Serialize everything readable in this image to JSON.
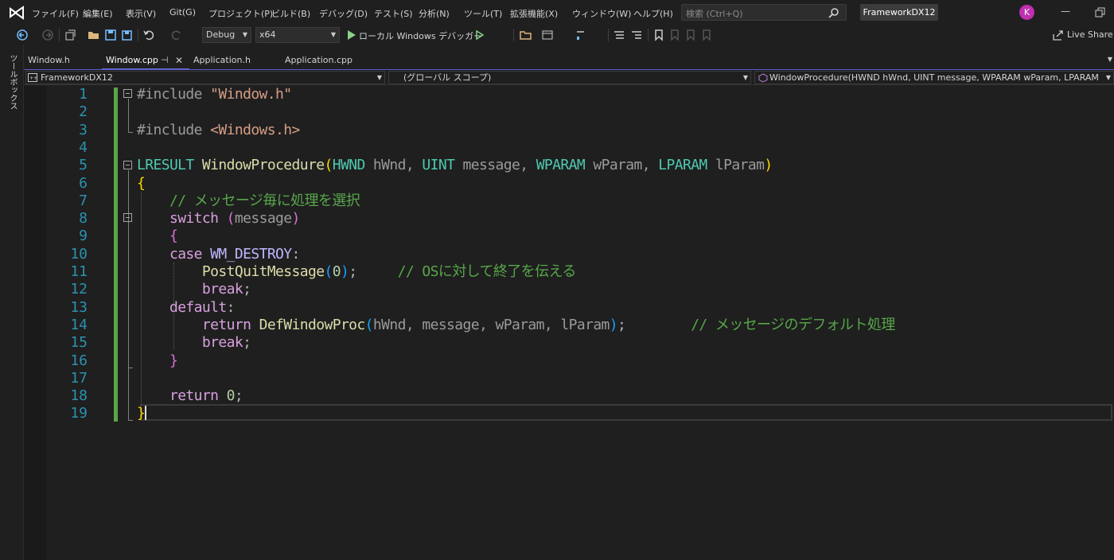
{
  "menu": {
    "items": [
      "ファイル(F)",
      "編集(E)",
      "表示(V)",
      "Git(G)",
      "プロジェクト(P)",
      "ビルド(B)",
      "デバッグ(D)",
      "テスト(S)",
      "分析(N)",
      "ツール(T)",
      "拡張機能(X)",
      "ウィンドウ(W)",
      "ヘルプ(H)"
    ],
    "search_placeholder": "検索 (Ctrl+Q)",
    "solution_name": "FrameworkDX12",
    "avatar_initial": "K"
  },
  "toolbar": {
    "config": "Debug",
    "platform": "x64",
    "run_label": "ローカル Windows デバッガー",
    "live_share": "Live Share"
  },
  "toolbox_label": "ツールボックス",
  "tabs": [
    {
      "label": "Window.h",
      "active": false
    },
    {
      "label": "Window.cpp",
      "active": true
    },
    {
      "label": "Application.h",
      "active": false
    },
    {
      "label": "Application.cpp",
      "active": false
    }
  ],
  "navbar": {
    "project": "FrameworkDX12",
    "scope": "(グローバル スコープ)",
    "member": "WindowProcedure(HWND hWnd, UINT message, WPARAM wParam, LPARAM lParam)"
  },
  "code": {
    "line_numbers": [
      "1",
      "2",
      "3",
      "4",
      "5",
      "6",
      "7",
      "8",
      "9",
      "10",
      "11",
      "12",
      "13",
      "14",
      "15",
      "16",
      "17",
      "18",
      "19"
    ],
    "lines": [
      [
        {
          "t": "#include ",
          "c": "pp"
        },
        {
          "t": "\"Window.h\"",
          "c": "str"
        }
      ],
      [],
      [
        {
          "t": "#include ",
          "c": "pp"
        },
        {
          "t": "<Windows.h>",
          "c": "str"
        }
      ],
      [],
      [
        {
          "t": "LRESULT",
          "c": "ty"
        },
        {
          "t": " ",
          "c": ""
        },
        {
          "t": "WindowProcedure",
          "c": "fn"
        },
        {
          "t": "(",
          "c": "br1"
        },
        {
          "t": "HWND",
          "c": "ty"
        },
        {
          "t": " hWnd, ",
          "c": "prm"
        },
        {
          "t": "UINT",
          "c": "ty"
        },
        {
          "t": " message, ",
          "c": "prm"
        },
        {
          "t": "WPARAM",
          "c": "ty"
        },
        {
          "t": " wParam, ",
          "c": "prm"
        },
        {
          "t": "LPARAM",
          "c": "ty"
        },
        {
          "t": " lParam",
          "c": "prm"
        },
        {
          "t": ")",
          "c": "br1"
        }
      ],
      [
        {
          "t": "{",
          "c": "br1"
        }
      ],
      [
        {
          "t": "    ",
          "c": ""
        },
        {
          "t": "// メッセージ毎に処理を選択",
          "c": "com"
        }
      ],
      [
        {
          "t": "    ",
          "c": ""
        },
        {
          "t": "switch",
          "c": "kw2"
        },
        {
          "t": " ",
          "c": ""
        },
        {
          "t": "(",
          "c": "br2"
        },
        {
          "t": "message",
          "c": "prm"
        },
        {
          "t": ")",
          "c": "br2"
        }
      ],
      [
        {
          "t": "    ",
          "c": ""
        },
        {
          "t": "{",
          "c": "br2"
        }
      ],
      [
        {
          "t": "    ",
          "c": ""
        },
        {
          "t": "case",
          "c": "kw2"
        },
        {
          "t": " ",
          "c": ""
        },
        {
          "t": "WM_DESTROY",
          "c": "mac"
        },
        {
          "t": ":",
          "c": "pn"
        }
      ],
      [
        {
          "t": "        ",
          "c": ""
        },
        {
          "t": "PostQuitMessage",
          "c": "fn"
        },
        {
          "t": "(",
          "c": "br3"
        },
        {
          "t": "0",
          "c": "num"
        },
        {
          "t": ")",
          "c": "br3"
        },
        {
          "t": ";     ",
          "c": "pn"
        },
        {
          "t": "// OSに対して終了を伝える",
          "c": "com"
        }
      ],
      [
        {
          "t": "        ",
          "c": ""
        },
        {
          "t": "break",
          "c": "kw2"
        },
        {
          "t": ";",
          "c": "pn"
        }
      ],
      [
        {
          "t": "    ",
          "c": ""
        },
        {
          "t": "default",
          "c": "kw2"
        },
        {
          "t": ":",
          "c": "pn"
        }
      ],
      [
        {
          "t": "        ",
          "c": ""
        },
        {
          "t": "return",
          "c": "kw2"
        },
        {
          "t": " ",
          "c": ""
        },
        {
          "t": "DefWindowProc",
          "c": "fn"
        },
        {
          "t": "(",
          "c": "br3"
        },
        {
          "t": "hWnd, message, wParam, lParam",
          "c": "prm"
        },
        {
          "t": ")",
          "c": "br3"
        },
        {
          "t": ";        ",
          "c": "pn"
        },
        {
          "t": "// メッセージのデフォルト処理",
          "c": "com"
        }
      ],
      [
        {
          "t": "        ",
          "c": ""
        },
        {
          "t": "break",
          "c": "kw2"
        },
        {
          "t": ";",
          "c": "pn"
        }
      ],
      [
        {
          "t": "    ",
          "c": ""
        },
        {
          "t": "}",
          "c": "br2"
        }
      ],
      [],
      [
        {
          "t": "    ",
          "c": ""
        },
        {
          "t": "return",
          "c": "kw2"
        },
        {
          "t": " ",
          "c": ""
        },
        {
          "t": "0",
          "c": "num"
        },
        {
          "t": ";",
          "c": "pn"
        }
      ],
      [
        {
          "t": "}",
          "c": "br1"
        }
      ]
    ]
  },
  "colors": {
    "accent": "#6d6dd8",
    "change_bar": "#57a64a",
    "line_number": "#2b91af"
  }
}
